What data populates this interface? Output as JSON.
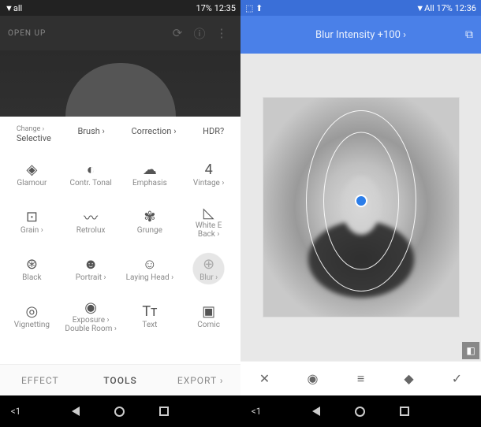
{
  "left": {
    "status": {
      "carrier": "▼all",
      "battery": "17%",
      "time": "12:35"
    },
    "topbar": {
      "title": "OPEN UP"
    },
    "row1": {
      "c1a": "Change ›",
      "c1b": "Selective",
      "c2": "Brush ›",
      "c3": "Correction ›",
      "c4": "HDR?"
    },
    "grid": [
      {
        "icon": "◈",
        "label": "Glamour"
      },
      {
        "icon": "◐",
        "label": "Contr. Tonal"
      },
      {
        "icon": "☁",
        "label": "Emphasis"
      },
      {
        "icon": "4",
        "label": "Vintage ›"
      },
      {
        "icon": "⊡",
        "label": "Grain ›"
      },
      {
        "icon": "〰",
        "label": "Retrolux"
      },
      {
        "icon": "✾",
        "label": "Grunge"
      },
      {
        "icon": "◺",
        "label": "White E\nBack ›"
      },
      {
        "icon": "⊛",
        "label": "Black"
      },
      {
        "icon": "☻",
        "label": "Portrait ›"
      },
      {
        "icon": "☺",
        "label": "Laying Head ›"
      },
      {
        "icon": "⊕",
        "label": "Blur ›"
      },
      {
        "icon": "◎",
        "label": "Vignetting"
      },
      {
        "icon": "◉",
        "label": "Exposure ›\nDouble Room ›"
      },
      {
        "icon": "Tᴛ",
        "label": "Text"
      },
      {
        "icon": "▣",
        "label": "Comic"
      }
    ],
    "tabs": {
      "t1": "EFFECT",
      "t2": "TOOLS",
      "t3": "EXPORT ›"
    },
    "nav": "<1"
  },
  "right": {
    "status": {
      "carrier": "▼All",
      "battery": "17%",
      "time": "12:36"
    },
    "header": "Blur Intensity +100 ›",
    "toolbar_icons": [
      "✕",
      "◉",
      "≡",
      "◆",
      "✓"
    ],
    "nav": "<1"
  }
}
